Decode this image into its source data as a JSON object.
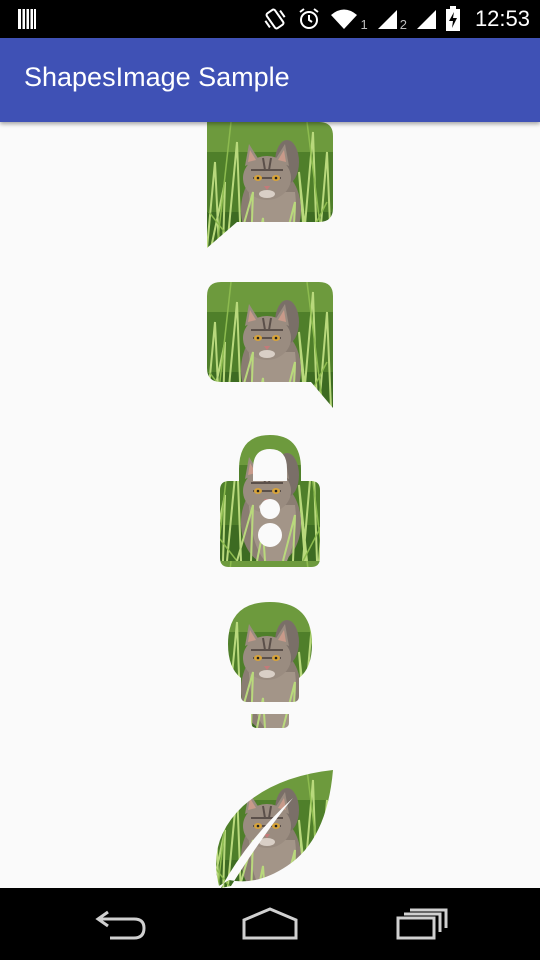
{
  "status_bar": {
    "sim1_label": "1",
    "sim2_label": "2",
    "time": "12:53",
    "icons": [
      "barcode-icon",
      "vibrate-icon",
      "alarm-icon",
      "wifi-icon",
      "signal-sim1-icon",
      "signal-sim2-icon",
      "battery-charging-icon"
    ]
  },
  "app_bar": {
    "title": "ShapesImage Sample",
    "color": "#3f51b5"
  },
  "shapes": [
    {
      "name": "bubble-left",
      "image": "cat-in-grass"
    },
    {
      "name": "bubble-right",
      "image": "cat-in-grass"
    },
    {
      "name": "lock",
      "image": "cat-in-grass"
    },
    {
      "name": "light-bulb",
      "image": "cat-in-grass"
    },
    {
      "name": "leaf",
      "image": "cat-in-grass"
    }
  ],
  "nav_bar": {
    "buttons": [
      "back",
      "home",
      "recent-apps"
    ]
  }
}
